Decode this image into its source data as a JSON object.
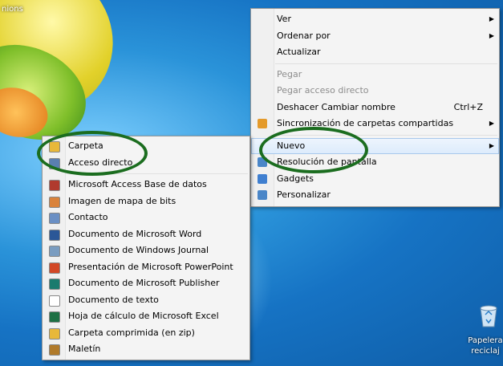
{
  "desktop": {
    "top_label": "nions",
    "recycle_bin": {
      "line1": "Papelera",
      "line2": "reciclaj"
    }
  },
  "context_menu": {
    "items": [
      {
        "label": "Ver",
        "submenu": true
      },
      {
        "label": "Ordenar por",
        "submenu": true
      },
      {
        "label": "Actualizar"
      },
      {
        "label": "Pegar",
        "disabled": true
      },
      {
        "label": "Pegar acceso directo",
        "disabled": true
      },
      {
        "label": "Deshacer Cambiar nombre",
        "shortcut": "Ctrl+Z"
      },
      {
        "label": "Sincronización de carpetas compartidas",
        "submenu": true,
        "icon": "sync-icon"
      },
      {
        "label": "Nuevo",
        "submenu": true,
        "highlighted": true
      },
      {
        "label": "Resolución de pantalla",
        "icon": "display-icon"
      },
      {
        "label": "Gadgets",
        "icon": "gadgets-icon"
      },
      {
        "label": "Personalizar",
        "icon": "personalize-icon"
      }
    ]
  },
  "new_submenu": {
    "items": [
      {
        "label": "Carpeta",
        "icon": "folder-icon",
        "color": "#e8b83a"
      },
      {
        "label": "Acceso directo",
        "icon": "shortcut-icon",
        "color": "#5a7fb0"
      },
      {
        "label": "Microsoft Access Base de datos",
        "icon": "access-icon",
        "color": "#b03a2e"
      },
      {
        "label": "Imagen de mapa de bits",
        "icon": "bitmap-icon",
        "color": "#d9823b"
      },
      {
        "label": "Contacto",
        "icon": "contact-icon",
        "color": "#6a8fc4"
      },
      {
        "label": "Documento de Microsoft Word",
        "icon": "word-icon",
        "color": "#2b5797"
      },
      {
        "label": "Documento de Windows Journal",
        "icon": "journal-icon",
        "color": "#7a9cc0"
      },
      {
        "label": "Presentación de Microsoft PowerPoint",
        "icon": "powerpoint-icon",
        "color": "#d24726"
      },
      {
        "label": "Documento de Microsoft Publisher",
        "icon": "publisher-icon",
        "color": "#1a7b6e"
      },
      {
        "label": "Documento de texto",
        "icon": "text-doc-icon",
        "color": "#ffffff"
      },
      {
        "label": "Hoja de cálculo de Microsoft Excel",
        "icon": "excel-icon",
        "color": "#1d7044"
      },
      {
        "label": "Carpeta comprimida (en zip)",
        "icon": "zip-folder-icon",
        "color": "#e8b83a"
      },
      {
        "label": "Maletín",
        "icon": "briefcase-icon",
        "color": "#b07a2a"
      }
    ]
  }
}
